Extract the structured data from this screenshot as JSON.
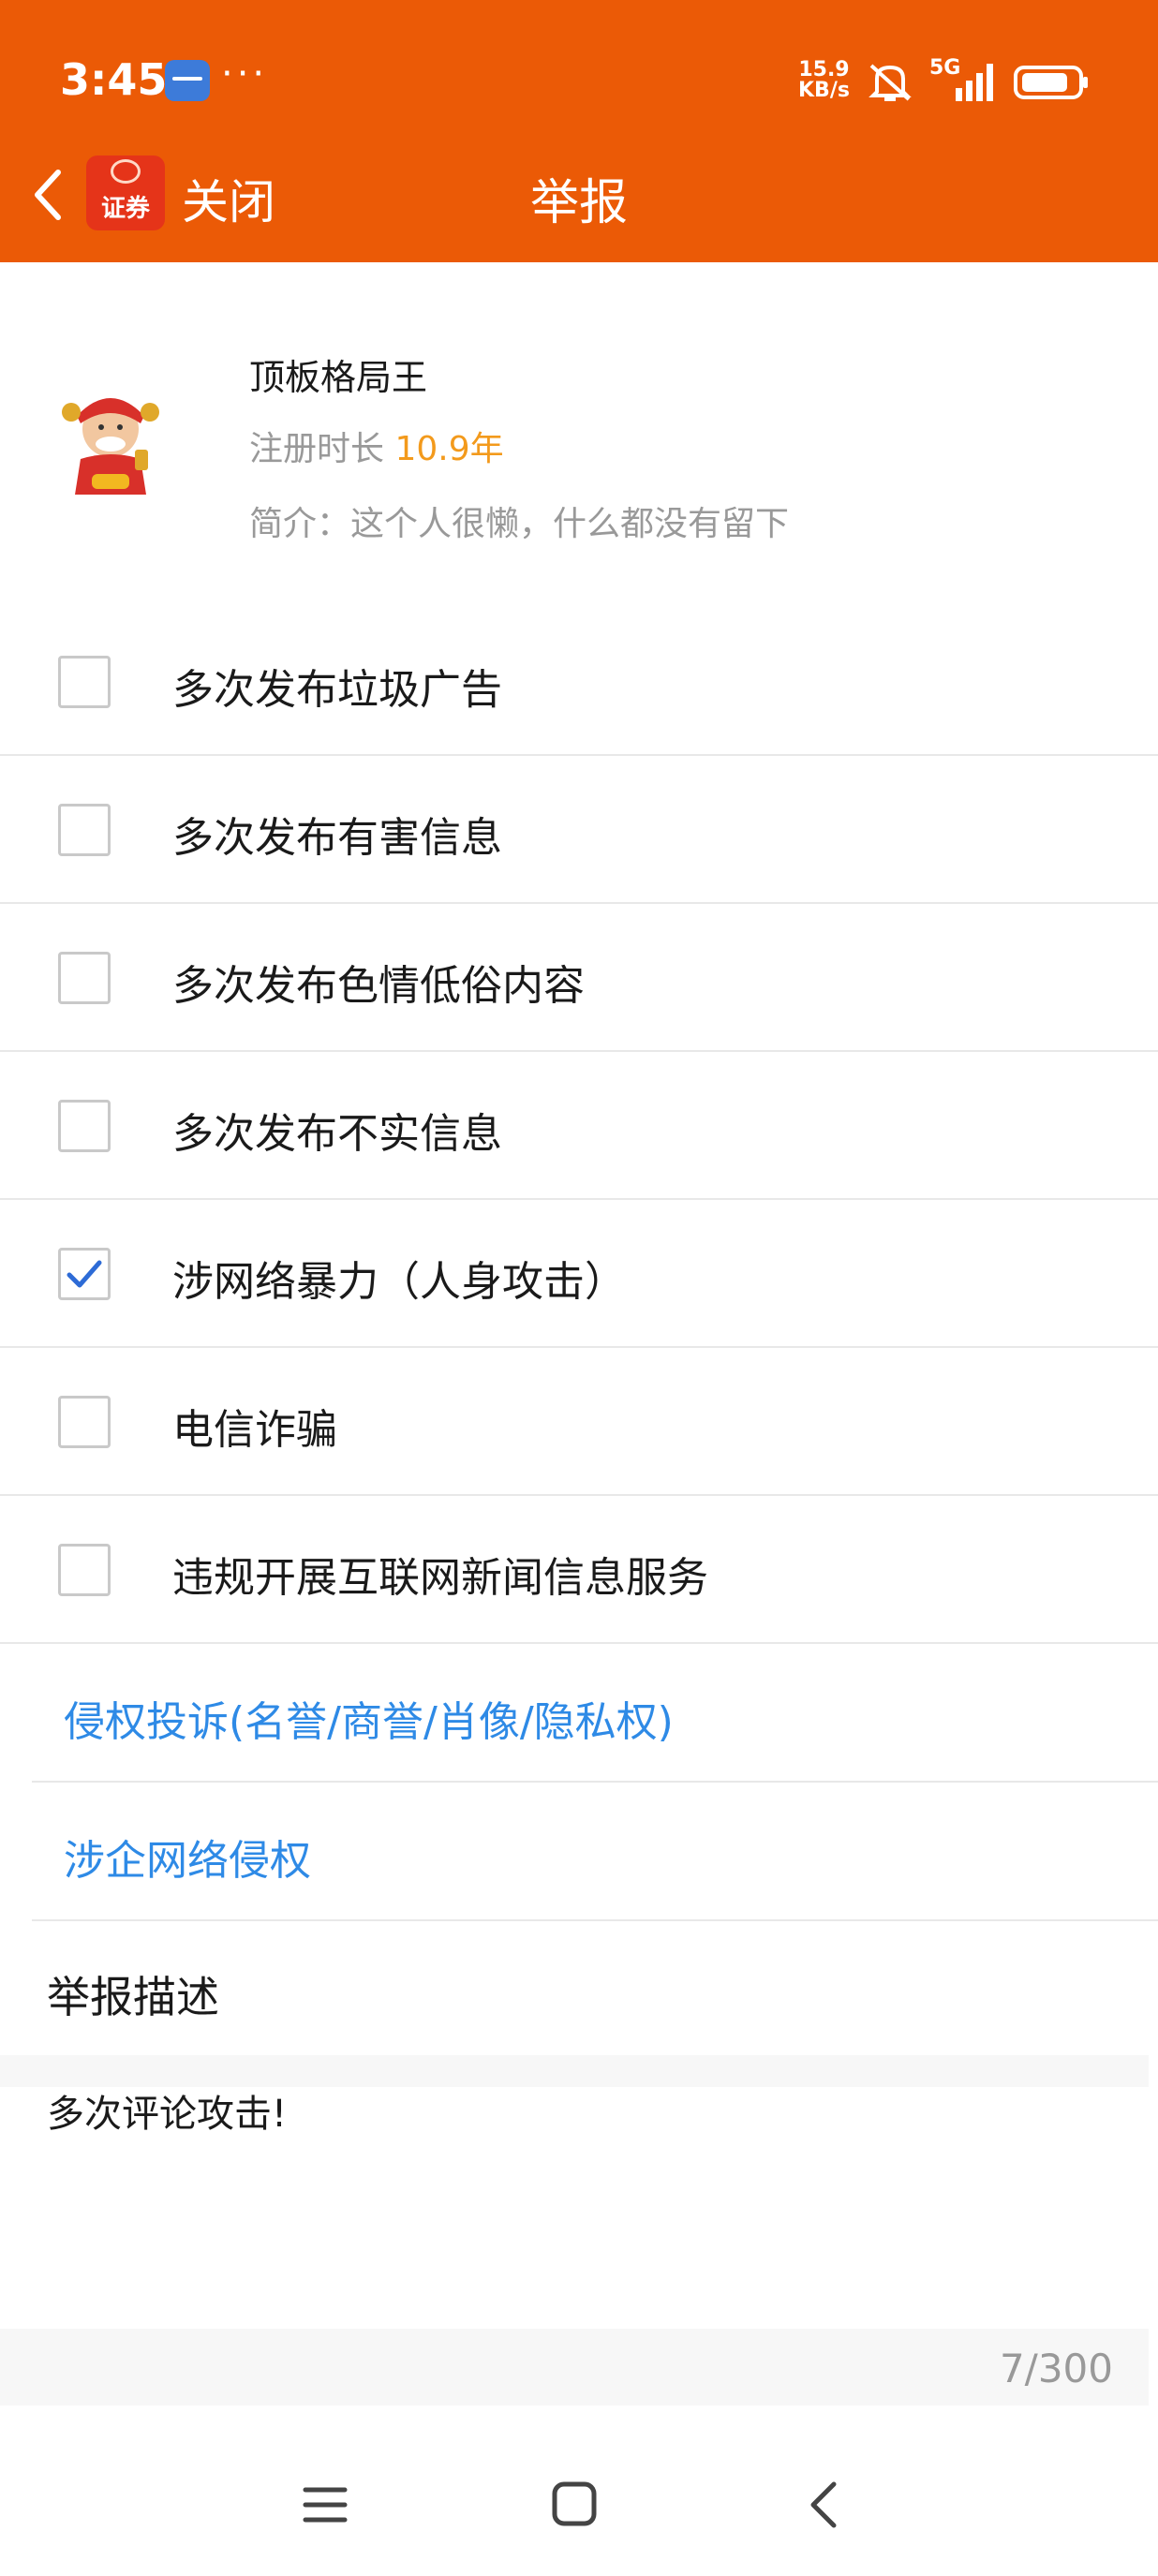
{
  "status_bar": {
    "time": "3:45",
    "more": "···",
    "net_speed_value": "15.9",
    "net_speed_unit": "KB/s",
    "network": "5G",
    "icons": [
      "app-notification-icon",
      "bell-muted-icon",
      "signal-icon",
      "battery-icon"
    ]
  },
  "nav": {
    "back_icon": "chevron-left-icon",
    "logo_text": "证券",
    "close_label": "关闭",
    "title": "举报"
  },
  "profile": {
    "username": "顶板格局王",
    "reg_label": "注册时长 ",
    "reg_value": "10.9年",
    "bio": "简介：这个人很懒，什么都没有留下"
  },
  "options": [
    {
      "label": "多次发布垃圾广告",
      "checked": false
    },
    {
      "label": "多次发布有害信息",
      "checked": false
    },
    {
      "label": "多次发布色情低俗内容",
      "checked": false
    },
    {
      "label": "多次发布不实信息",
      "checked": false
    },
    {
      "label": "涉网络暴力（人身攻击）",
      "checked": true
    },
    {
      "label": "电信诈骗",
      "checked": false
    },
    {
      "label": "违规开展互联网新闻信息服务",
      "checked": false
    }
  ],
  "links": [
    {
      "label": "侵权投诉(名誉/商誉/肖像/隐私权)"
    },
    {
      "label": "涉企网络侵权"
    }
  ],
  "description": {
    "title": "举报描述",
    "text": "多次评论攻击!",
    "count": "7/300"
  },
  "colors": {
    "header_bg": "#eb5a06",
    "link": "#2e8ae6",
    "reg_value": "#f39a1c",
    "checkbox_check": "#2d6bd6"
  }
}
